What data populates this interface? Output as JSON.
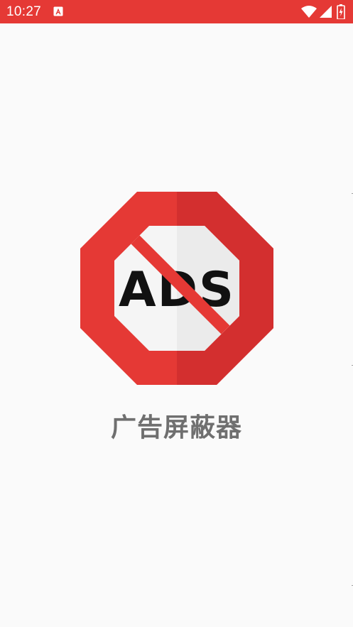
{
  "status_bar": {
    "time": "10:27",
    "background": "#e53935",
    "icons": [
      "notification-a-icon",
      "wifi-icon",
      "signal-icon",
      "battery-charging-icon"
    ]
  },
  "splash": {
    "logo": {
      "text": "ADS",
      "icon": "no-ads-stop-sign-icon",
      "colors": {
        "octagon": "#e53935",
        "octagon_shade": "#d32f2f",
        "inner": "#f5f5f5",
        "inner_shade": "#ebebeb",
        "text": "#111111"
      }
    },
    "app_name": "广告屏蔽器"
  }
}
